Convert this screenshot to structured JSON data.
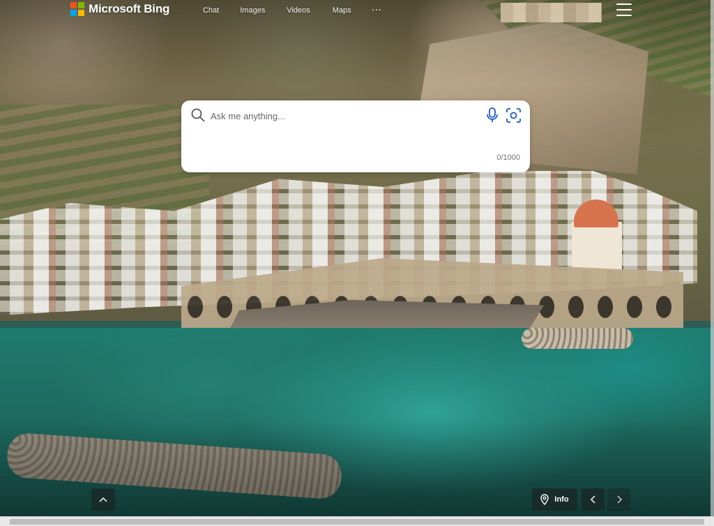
{
  "brand": {
    "name": "Microsoft Bing",
    "logo_colors": [
      "#f25022",
      "#7fba00",
      "#00a4ef",
      "#ffb900"
    ]
  },
  "nav": {
    "items": [
      "Chat",
      "Images",
      "Videos",
      "Maps"
    ],
    "more_label": "···"
  },
  "search": {
    "placeholder": "Ask me anything...",
    "value": "",
    "char_count": "0/1000",
    "icon": "search-icon",
    "mic_icon": "microphone-icon",
    "visual_icon": "visual-search-icon",
    "accent_color": "#1a56c4"
  },
  "image_controls": {
    "info_label": "Info",
    "location_icon": "location-pin-icon",
    "prev_icon": "chevron-left-icon",
    "next_icon": "chevron-right-icon",
    "scroll_up_icon": "chevron-up-icon"
  },
  "menu": {
    "icon": "hamburger-menu-icon"
  }
}
